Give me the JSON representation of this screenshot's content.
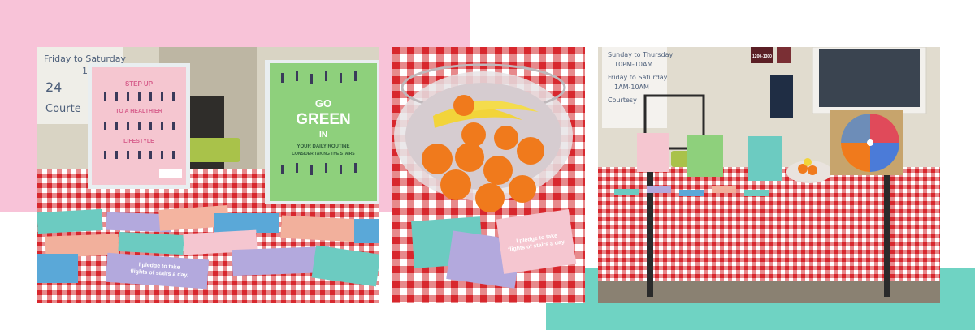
{
  "photos": [
    {
      "poster_left": {
        "line1": "STEP UP",
        "line2": "TO A HEALTHIER",
        "line3": "LIFESTYLE"
      },
      "poster_right": {
        "line1": "GO",
        "line2": "GREEN",
        "line3": "IN",
        "line4": "YOUR DAILY ROUTINE",
        "line5": "CONSIDER TAKING THE STAIRS"
      },
      "whiteboard": {
        "line1": "Friday to Saturday",
        "line2": "1AM",
        "line3": "24",
        "line4": "Courte"
      },
      "card_pledge": {
        "line1": "I pledge to take",
        "line2": "flights of stairs a day."
      }
    },
    {
      "card_pledge": {
        "line1": "I pledge to take",
        "line2": "flights of stairs a day."
      }
    },
    {
      "whiteboard": {
        "line1": "Sunday to Thursday",
        "line2": "10PM-10AM",
        "line3": "Friday to Saturday",
        "line4": "1AM-10AM",
        "line5": "Courtesy"
      },
      "door_sign": "1200-1300"
    }
  ],
  "colors": {
    "pink_block": "#f8c3d8",
    "teal_block": "#6fd3c3",
    "tablecloth_red": "#d8272d"
  }
}
